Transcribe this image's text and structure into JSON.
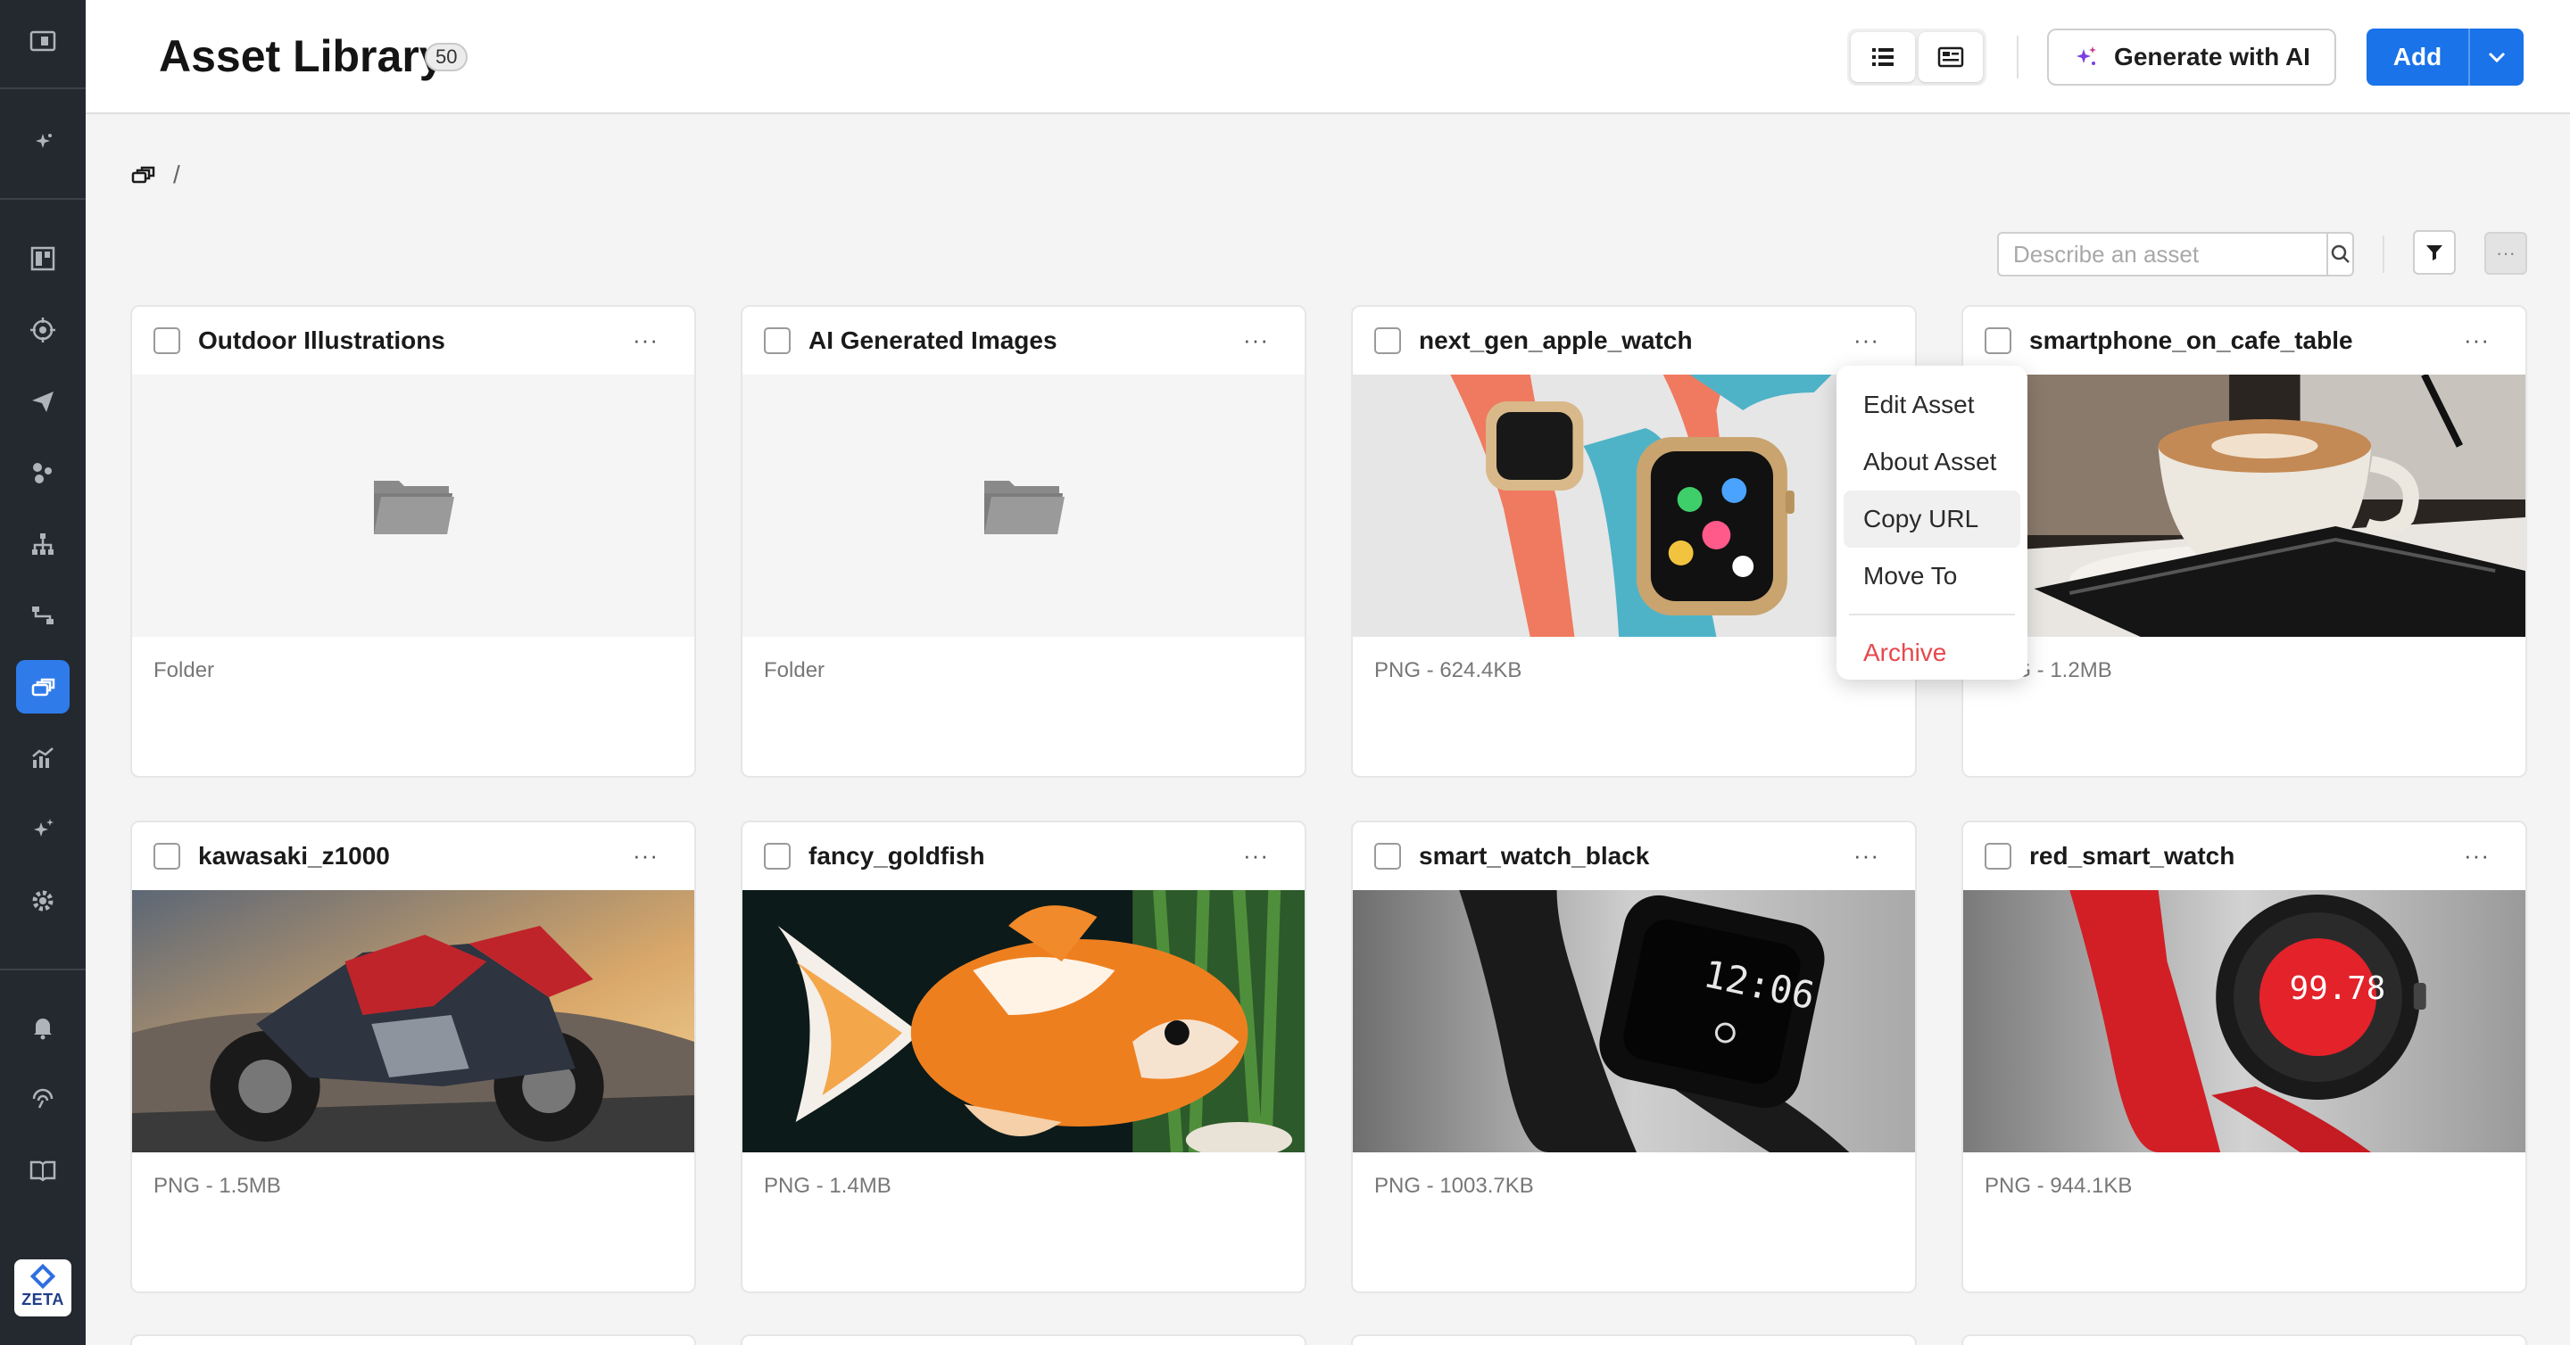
{
  "header": {
    "title": "Asset Library",
    "count": "50",
    "generate_label": "Generate with AI",
    "add_label": "Add"
  },
  "breadcrumb": {
    "separator": "/"
  },
  "toolbar": {
    "search_placeholder": "Describe an asset"
  },
  "cards": [
    {
      "name": "Outdoor Illustrations",
      "meta": "Folder",
      "kind": "folder"
    },
    {
      "name": "AI Generated Images",
      "meta": "Folder",
      "kind": "folder"
    },
    {
      "name": "next_gen_apple_watch",
      "meta": "PNG - 624.4KB",
      "kind": "image",
      "icon": "watch-image"
    },
    {
      "name": "smartphone_on_cafe_table",
      "meta": "PNG - 1.2MB",
      "kind": "image",
      "icon": "coffee-phone-image"
    },
    {
      "name": "kawasaki_z1000",
      "meta": "PNG - 1.5MB",
      "kind": "image",
      "icon": "motorcycle-image"
    },
    {
      "name": "fancy_goldfish",
      "meta": "PNG - 1.4MB",
      "kind": "image",
      "icon": "goldfish-image"
    },
    {
      "name": "smart_watch_black",
      "meta": "PNG - 1003.7KB",
      "kind": "image",
      "icon": "black-watch-image"
    },
    {
      "name": "red_smart_watch",
      "meta": "PNG - 944.1KB",
      "kind": "image",
      "icon": "red-watch-image"
    }
  ],
  "context_menu": {
    "items": [
      "Edit Asset",
      "About Asset",
      "Copy URL",
      "Move To"
    ],
    "danger_item": "Archive",
    "hovered": "Copy URL"
  },
  "watch_face_text": {
    "black": "12:06",
    "red": "99.78"
  },
  "colors": {
    "accent": "#1a73e8",
    "sidebar": "#23292f",
    "active_nav": "#2f7bea",
    "danger": "#e5484d"
  }
}
